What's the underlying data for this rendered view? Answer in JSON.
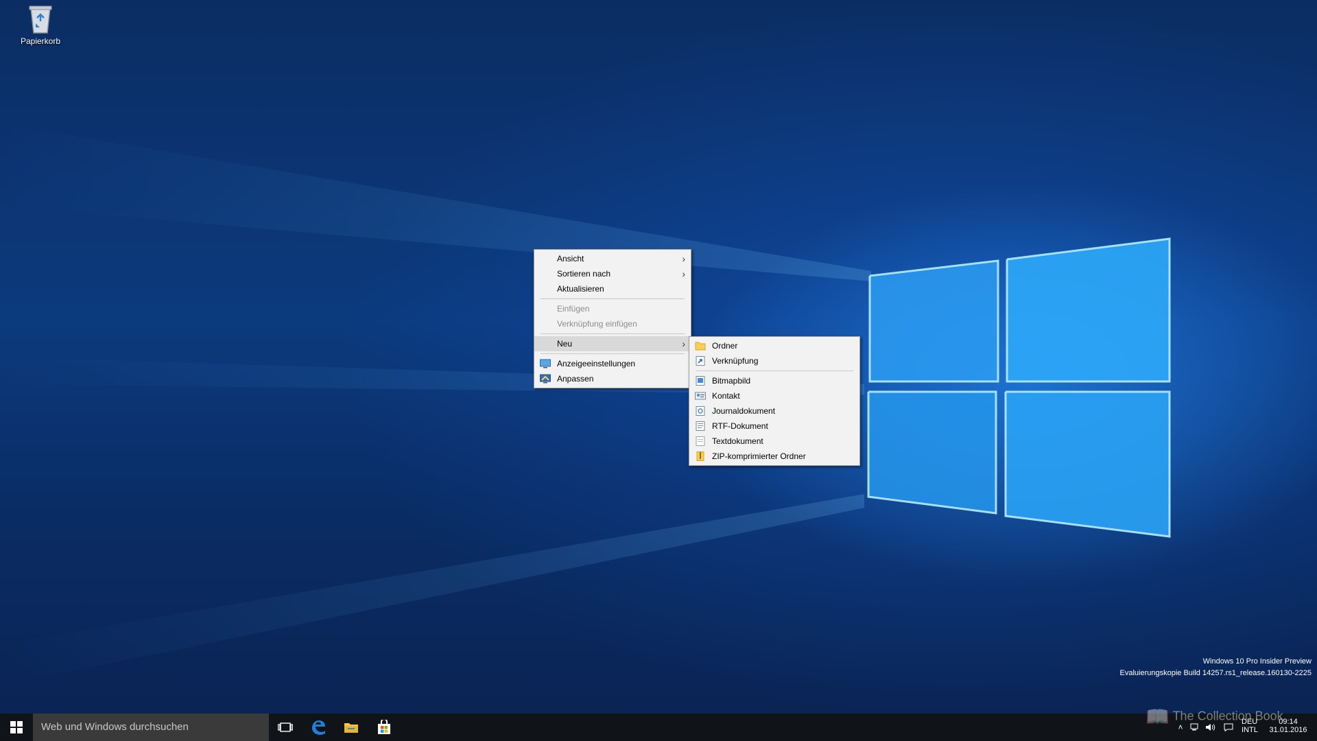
{
  "desktop": {
    "icons": [
      {
        "label": "Papierkorb",
        "icon": "recycle-bin-icon"
      }
    ],
    "watermark": {
      "line1": "Windows 10 Pro Insider Preview",
      "line2": "Evaluierungskopie Build 14257.rs1_release.160130-2225"
    }
  },
  "context_menu": {
    "items": [
      {
        "label": "Ansicht",
        "submenu": true
      },
      {
        "label": "Sortieren nach",
        "submenu": true
      },
      {
        "label": "Aktualisieren"
      },
      {
        "label": "Einfügen",
        "disabled": true
      },
      {
        "label": "Verknüpfung einfügen",
        "disabled": true
      },
      {
        "label": "Neu",
        "submenu": true,
        "active": true
      },
      {
        "label": "Anzeigeeinstellungen",
        "icon": "display-settings-icon"
      },
      {
        "label": "Anpassen",
        "icon": "personalize-icon"
      }
    ]
  },
  "submenu_neu": {
    "items": [
      {
        "label": "Ordner",
        "icon": "folder-icon"
      },
      {
        "label": "Verknüpfung",
        "icon": "shortcut-icon"
      },
      {
        "label": "Bitmapbild",
        "icon": "bitmap-icon"
      },
      {
        "label": "Kontakt",
        "icon": "contact-icon"
      },
      {
        "label": "Journaldokument",
        "icon": "journal-icon"
      },
      {
        "label": "RTF-Dokument",
        "icon": "rtf-document-icon"
      },
      {
        "label": "Textdokument",
        "icon": "text-document-icon"
      },
      {
        "label": "ZIP-komprimierter Ordner",
        "icon": "zip-folder-icon"
      }
    ]
  },
  "taskbar": {
    "search_placeholder": "Web und Windows durchsuchen",
    "pinned": [
      "task-view-icon",
      "edge-icon",
      "file-explorer-icon",
      "store-icon"
    ],
    "language_top": "DEU",
    "language_bottom": "INTL",
    "time": "09:14",
    "date": "31.01.2016"
  },
  "brand_overlay": "The Collection Book",
  "colors": {
    "menu_bg": "#f2f2f2",
    "menu_active": "#d9d9d9",
    "taskbar_bg": "#101418",
    "accent": "#0078d7"
  }
}
